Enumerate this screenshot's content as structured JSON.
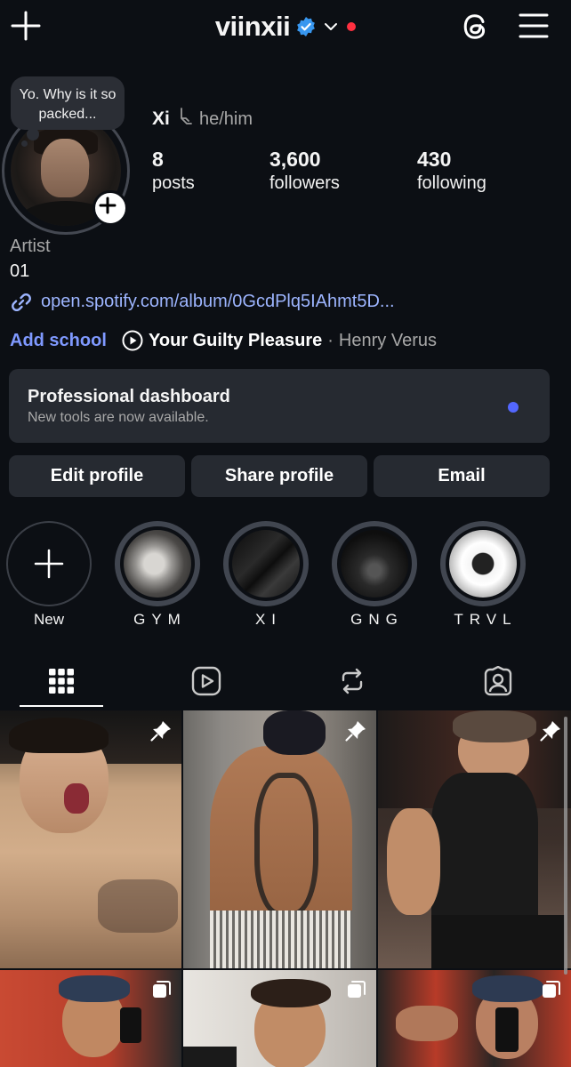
{
  "header": {
    "username": "viinxii",
    "verified_color": "#3897f0",
    "notification_dot_color": "#ff3040",
    "icons": [
      "plus-icon",
      "chevron-down-icon",
      "threads-icon",
      "hamburger-menu-icon"
    ]
  },
  "profile": {
    "note": "Yo. Why is it so packed...",
    "name": "Xi",
    "pronouns": "he/him",
    "stats": [
      {
        "value": "8",
        "label": "posts"
      },
      {
        "value": "3,600",
        "label": "followers"
      },
      {
        "value": "430",
        "label": "following"
      }
    ],
    "category": "Artist",
    "bio": "01",
    "link": "open.spotify.com/album/0GcdPlq5IAhmt5D...",
    "add_school": "Add school",
    "music": {
      "song": "Your Guilty Pleasure",
      "separator": "·",
      "artist": "Henry Verus"
    }
  },
  "dashboard": {
    "title": "Professional dashboard",
    "subtitle": "New tools are now available.",
    "dot_color": "#5367ff"
  },
  "buttons": {
    "edit": "Edit profile",
    "share": "Share profile",
    "email": "Email"
  },
  "highlights": [
    {
      "label": "New"
    },
    {
      "label": "GYM"
    },
    {
      "label": "XI"
    },
    {
      "label": "GNG"
    },
    {
      "label": "TRVL"
    }
  ],
  "tabs": [
    "grid-icon",
    "reels-icon",
    "reposts-icon",
    "tagged-icon"
  ],
  "posts": [
    {
      "kind": "pinned"
    },
    {
      "kind": "pinned"
    },
    {
      "kind": "pinned"
    },
    {
      "kind": "carousel"
    },
    {
      "kind": "carousel"
    },
    {
      "kind": "carousel"
    }
  ]
}
